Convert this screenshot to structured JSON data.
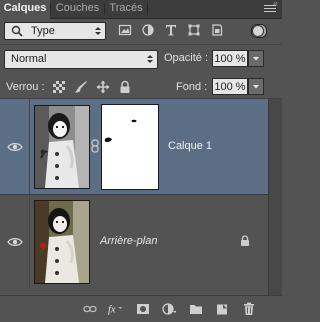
{
  "tabs": [
    {
      "label": "Calques",
      "active": true
    },
    {
      "label": "Couches",
      "active": false
    },
    {
      "label": "Tracés",
      "active": false
    }
  ],
  "filter": {
    "type_label": "Type",
    "icons": [
      "image-filter-icon",
      "adjustment-filter-icon",
      "text-filter-icon",
      "shape-filter-icon",
      "smart-object-filter-icon"
    ]
  },
  "blend": {
    "mode": "Normal"
  },
  "opacity": {
    "label": "Opacité :",
    "value": "100 %"
  },
  "lock": {
    "label": "Verrou :"
  },
  "fill": {
    "label": "Fond :",
    "value": "100 %"
  },
  "layers": [
    {
      "name": "Calque 1",
      "visible": true,
      "selected": true,
      "has_mask": true
    },
    {
      "name": "Arrière-plan",
      "visible": true,
      "selected": false,
      "locked": true
    }
  ],
  "colors": {
    "panel_bg": "#535353",
    "selected_row": "#5b6e86",
    "tab_bar": "#3c3c3c"
  }
}
